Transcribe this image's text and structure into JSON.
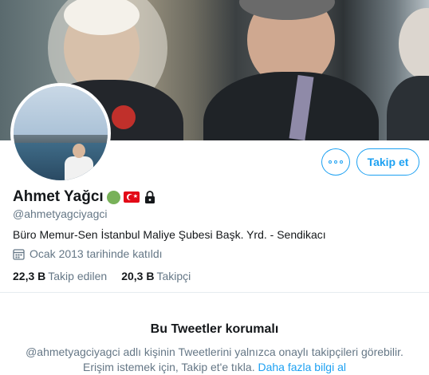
{
  "profile": {
    "name": "Ahmet Yağcı",
    "handle": "@ahmetyagciyagci",
    "bio": "Büro Memur-Sen İstanbul Maliye Şubesi Başk. Yrd. - Sendikacı",
    "joined": "Ocak 2013 tarihinde katıldı",
    "name_badges": [
      "green-circle-icon",
      "turkey-flag-icon",
      "lock-icon"
    ]
  },
  "actions": {
    "more_icon": "more-options-icon",
    "follow_label": "Takip et"
  },
  "stats": {
    "following_count": "22,3 B",
    "following_label": "Takip edilen",
    "followers_count": "20,3 B",
    "followers_label": "Takipçi"
  },
  "protected": {
    "title": "Bu Tweetler korumalı",
    "text": "@ahmetyagciyagci adlı kişinin Tweetlerini yalnızca onaylı takipçileri görebilir. Erişim istemek için, Takip et'e tıkla.",
    "link": "Daha fazla bilgi al"
  },
  "colors": {
    "accent": "#1da1f2",
    "secondary_text": "#657786",
    "primary_text": "#14171a"
  }
}
